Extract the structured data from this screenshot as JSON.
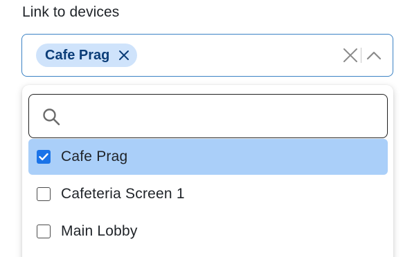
{
  "field": {
    "label": "Link to devices"
  },
  "selected_chips": [
    {
      "label": "Cafe Prag"
    }
  ],
  "icons": {
    "chip_remove": "close-icon",
    "clear": "clear-icon",
    "toggle": "chevron-up-icon",
    "search": "search-icon",
    "checkbox_checked": "checkbox-checked-icon",
    "checkbox_unchecked": "checkbox-unchecked-icon"
  },
  "search": {
    "value": "",
    "placeholder": ""
  },
  "options": [
    {
      "label": "Cafe Prag",
      "checked": true
    },
    {
      "label": "Cafeteria Screen 1",
      "checked": false
    },
    {
      "label": "Main Lobby",
      "checked": false
    }
  ],
  "colors": {
    "accent": "#1a73e8",
    "chip_background": "#cfe3fb",
    "chip_text": "#0b3d78",
    "selected_option_background": "#aacff9",
    "field_border": "#3b82c4"
  }
}
